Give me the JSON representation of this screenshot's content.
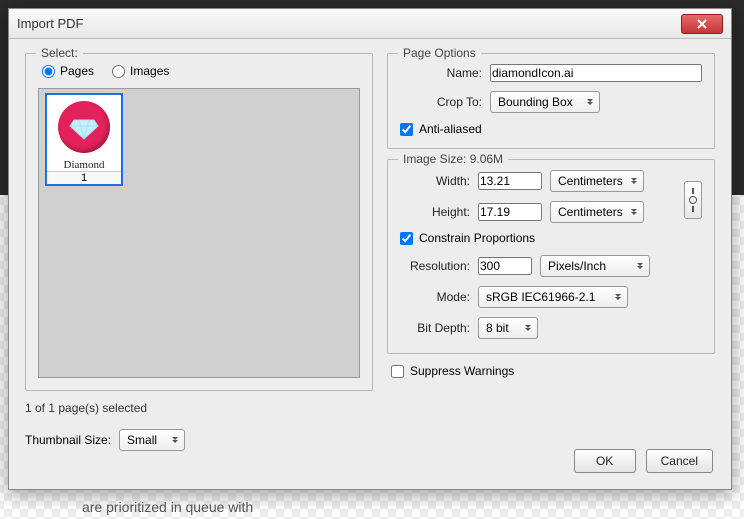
{
  "dialog": {
    "title": "Import PDF"
  },
  "select": {
    "legend": "Select:",
    "radioPages": "Pages",
    "radioImages": "Images",
    "thumbCaption": "Diamond",
    "thumbNum": "1",
    "status": "1 of 1 page(s) selected",
    "thumbSizeLabel": "Thumbnail Size:",
    "thumbSizeValue": "Small"
  },
  "pageOptions": {
    "legend": "Page Options",
    "nameLabel": "Name:",
    "nameValue": "diamondIcon.ai",
    "cropLabel": "Crop To:",
    "cropValue": "Bounding Box",
    "antiAliased": "Anti-aliased"
  },
  "imageSize": {
    "legend": "Image Size: 9.06M",
    "widthLabel": "Width:",
    "widthValue": "13.21",
    "widthUnit": "Centimeters",
    "heightLabel": "Height:",
    "heightValue": "17.19",
    "heightUnit": "Centimeters",
    "constrain": "Constrain Proportions",
    "resLabel": "Resolution:",
    "resValue": "300",
    "resUnit": "Pixels/Inch",
    "modeLabel": "Mode:",
    "modeValue": "sRGB IEC61966-2.1",
    "bitLabel": "Bit Depth:",
    "bitValue": "8 bit"
  },
  "suppress": "Suppress Warnings",
  "buttons": {
    "ok": "OK",
    "cancel": "Cancel"
  },
  "backtext": "are prioritized in queue with"
}
